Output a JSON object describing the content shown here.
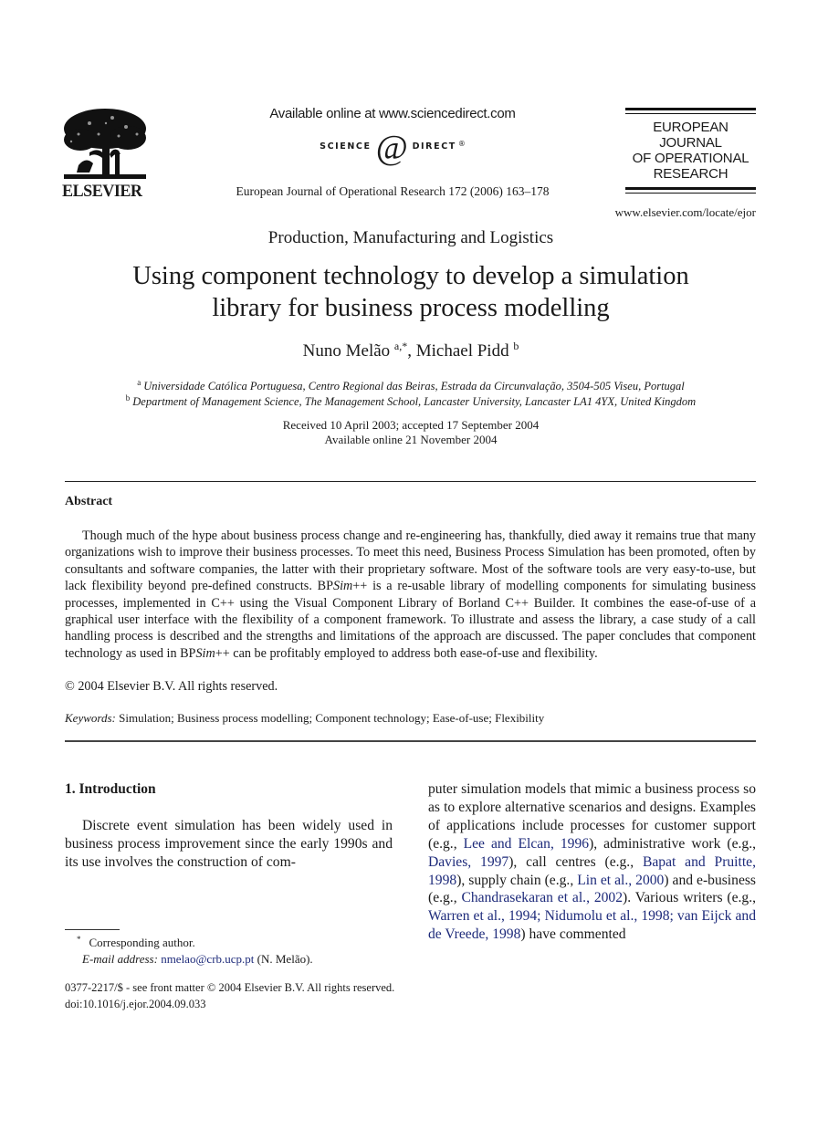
{
  "header": {
    "publisher_name": "ELSEVIER",
    "sciencedirect_online": "Available online at www.sciencedirect.com",
    "sciencedirect_left": "SCIENCE",
    "sciencedirect_at": "d",
    "sciencedirect_right": "DIRECT",
    "sciencedirect_reg": "®",
    "journal_ref": "European Journal of Operational Research 172 (2006) 163–178",
    "journal_logo_lines": [
      "EUROPEAN",
      "JOURNAL",
      "OF OPERATIONAL",
      "RESEARCH"
    ],
    "journal_url": "www.elsevier.com/locate/ejor"
  },
  "article": {
    "section": "Production, Manufacturing and Logistics",
    "title_line1": "Using component technology to develop a simulation",
    "title_line2": "library for business process modelling",
    "authors": [
      {
        "name": "Nuno Melão",
        "sup": "a,*"
      },
      {
        "name": "Michael Pidd",
        "sup": "b"
      }
    ],
    "author_separator": ", ",
    "affiliations": [
      {
        "mark": "a",
        "text": "Universidade Católica Portuguesa, Centro Regional das Beiras, Estrada da Circunvalação, 3504-505 Viseu, Portugal"
      },
      {
        "mark": "b",
        "text": "Department of Management Science, The Management School, Lancaster University, Lancaster LA1 4YX, United Kingdom"
      }
    ],
    "received": "Received 10 April 2003; accepted 17 September 2004",
    "available": "Available online 21 November 2004"
  },
  "abstract": {
    "heading": "Abstract",
    "p1": "Though much of the hype about business process change and re-engineering has, thankfully, died away it remains true that many organizations wish to improve their business processes. To meet this need, Business Process Simulation has been promoted, often by consultants and software companies, the latter with their proprietary software. Most of the software tools are very easy-to-use, but lack flexibility beyond pre-defined constructs. BP",
    "sim_italic": "Sim",
    "p1b": "++ is a re-usable library of modelling components for simulating business processes, implemented in C++ using the Visual Component Library of Borland C++ Builder. It combines the ease-of-use of a graphical user interface with the flexibility of a component framework. To illustrate and assess the library, a case study of a call handling process is described and the strengths and limitations of the approach are discussed. The paper concludes that component technology as used in BP",
    "p1c": "++ can be profitably employed to address both ease-of-use and flexibility.",
    "copyright": "© 2004 Elsevier B.V. All rights reserved."
  },
  "keywords": {
    "label": "Keywords:",
    "text": "Simulation; Business process modelling; Component technology; Ease-of-use; Flexibility"
  },
  "introduction": {
    "heading": "1. Introduction",
    "left_text": "Discrete event simulation has been widely used in business process improvement since the early 1990s and its use involves the construction of com-",
    "right": {
      "t1": "puter simulation models that mimic a business process so as to explore alternative scenarios and designs. Examples of applications include processes for customer support (e.g., ",
      "c1": "Lee and Elcan, 1996",
      "t2": "), administrative work (e.g., ",
      "c2": "Davies, 1997",
      "t3": "), call centres (e.g., ",
      "c3": "Bapat and Pruitte, 1998",
      "t4": "), supply chain (e.g., ",
      "c4": "Lin et al., 2000",
      "t5": ") and e-business (e.g., ",
      "c5": "Chandrasekaran et al., 2002",
      "t6": "). Various writers (e.g., ",
      "c6": "Warren et al., 1994; Nidumolu et al., 1998; van Eijck and de Vreede, 1998",
      "t7": ") have commented"
    }
  },
  "footnote": {
    "mark": "*",
    "corresponding": "Corresponding author.",
    "email_label": "E-mail address:",
    "email": "nmelao@crb.ucp.pt",
    "email_suffix": " (N. Melão)."
  },
  "footer": {
    "issn": "0377-2217/$ - see front matter © 2004 Elsevier B.V. All rights reserved.",
    "doi": "doi:10.1016/j.ejor.2004.09.033"
  },
  "colors": {
    "citation_link": "#1d2a7a",
    "text": "#1a1a1a"
  }
}
